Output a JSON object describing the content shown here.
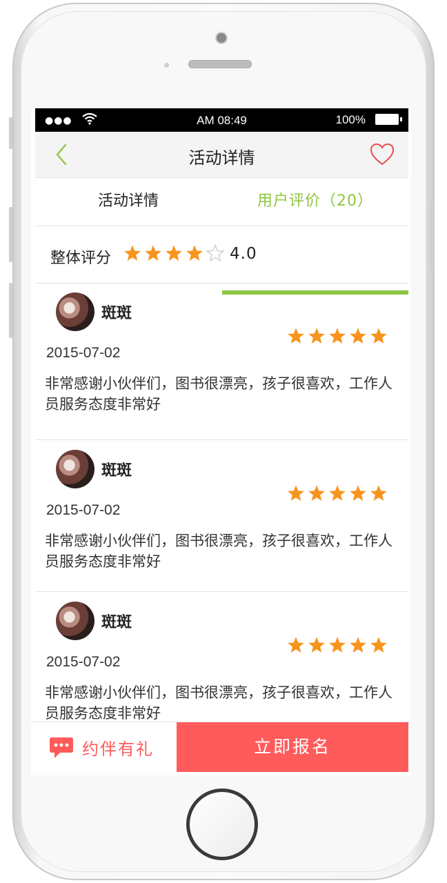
{
  "status_bar": {
    "signal": "●●●",
    "time": "AM 08:49",
    "battery": "100%"
  },
  "nav": {
    "title": "活动详情"
  },
  "tabs": [
    {
      "label": "活动详情",
      "active": false
    },
    {
      "label": "用户评价（20）",
      "active": true
    }
  ],
  "overall": {
    "label": "整体评分",
    "rating": 4,
    "max": 5,
    "score_text": "4.0"
  },
  "reviews": [
    {
      "user": "斑斑",
      "rating": 5,
      "date": "2015-07-02",
      "text": "非常感谢小伙伴们，图书很漂亮，孩子很喜欢，工作人员服务态度非常好"
    },
    {
      "user": "斑斑",
      "rating": 5,
      "date": "2015-07-02",
      "text": "非常感谢小伙伴们，图书很漂亮，孩子很喜欢，工作人员服务态度非常好"
    },
    {
      "user": "斑斑",
      "rating": 5,
      "date": "2015-07-02",
      "text": "非常感谢小伙伴们，图书很漂亮，孩子很喜欢，工作人员服务态度非常好"
    }
  ],
  "bottom": {
    "invite_label": "约伴有礼",
    "signup_label": "立即报名"
  },
  "colors": {
    "accent_green": "#8dc63f",
    "star_orange": "#f7941d",
    "cta_red": "#ff5b5b",
    "heart_red": "#e84c4c"
  },
  "icons": [
    "wifi-icon",
    "battery-icon",
    "back-chevron-icon",
    "heart-icon",
    "star-icon",
    "chat-bubble-icon"
  ]
}
